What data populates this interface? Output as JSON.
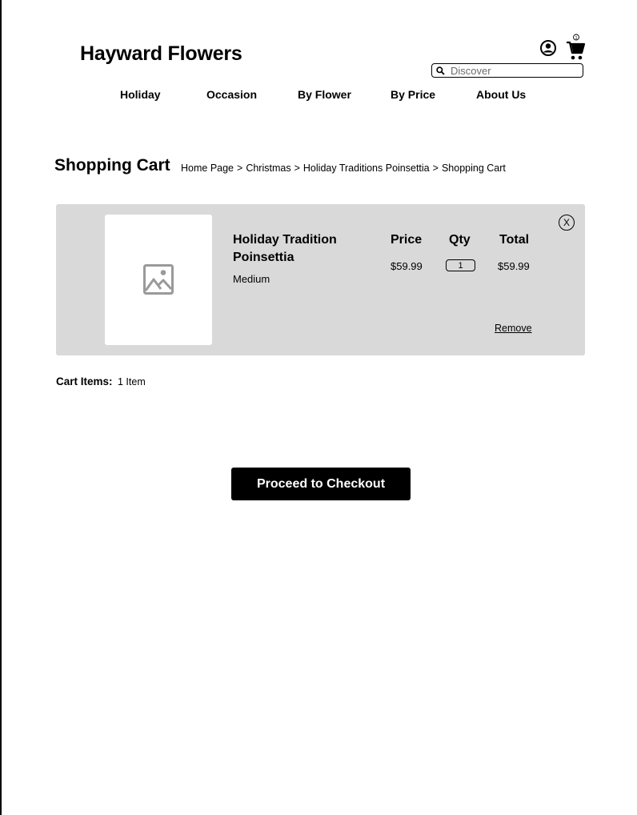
{
  "header": {
    "logo": "Hayward Flowers",
    "cart_count": "1",
    "search": {
      "placeholder": "Discover",
      "value": ""
    },
    "icons": {
      "account": "account-circle-icon",
      "cart": "shopping-cart-icon",
      "search": "search-icon"
    }
  },
  "nav": {
    "items": [
      "Holiday",
      "Occasion",
      "By Flower",
      "By Price",
      "About Us"
    ]
  },
  "page": {
    "title": "Shopping Cart",
    "breadcrumb": [
      "Home Page",
      "Christmas",
      "Holiday Traditions Poinsettia",
      "Shopping Cart"
    ],
    "breadcrumb_separator": ">"
  },
  "cart": {
    "columns": {
      "price": "Price",
      "qty": "Qty",
      "total": "Total"
    },
    "items": [
      {
        "name": "Holiday Tradition Poinsettia",
        "size": "Medium",
        "price": "$59.99",
        "qty": "1",
        "total": "$59.99",
        "remove_label": "Remove",
        "close_label": "X",
        "image_icon": "image-placeholder-icon"
      }
    ],
    "summary": {
      "label": "Cart Items:",
      "value": "1 Item"
    },
    "checkout_label": "Proceed to Checkout"
  },
  "colors": {
    "panel": "#d9d9d9",
    "button": "#000000",
    "button_text": "#ffffff",
    "placeholder_icon": "#9a9a9a"
  }
}
